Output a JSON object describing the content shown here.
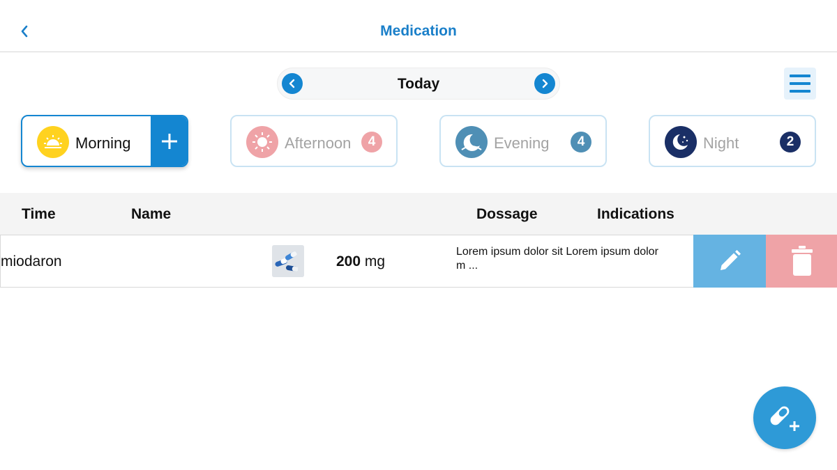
{
  "header": {
    "title": "Medication",
    "back_icon": "chevron-left-icon"
  },
  "date_nav": {
    "label": "Today",
    "prev_icon": "chevron-left-icon",
    "next_icon": "chevron-right-icon"
  },
  "menu_icon": "hamburger-menu-icon",
  "periods": [
    {
      "label": "Morning",
      "icon": "sunrise-icon",
      "icon_bg": "#ffd21f",
      "active": true,
      "action_icon": "plus-icon"
    },
    {
      "label": "Afternoon",
      "icon": "sun-icon",
      "icon_bg": "#efa3a7",
      "badge": "4",
      "badge_color": "#efa3a7"
    },
    {
      "label": "Evening",
      "icon": "moon-evening-icon",
      "icon_bg": "#4f8fb5",
      "badge": "4",
      "badge_color": "#4f8fb5"
    },
    {
      "label": "Night",
      "icon": "moon-stars-icon",
      "icon_bg": "#1a2f66",
      "badge": "2",
      "badge_color": "#1a2f66"
    }
  ],
  "table": {
    "columns": [
      "Time",
      "Name",
      "Dossage",
      "Indications"
    ],
    "rows": [
      {
        "name": "miodaron",
        "image": "pills-thumbnail",
        "dose_value": "200",
        "dose_unit": "mg",
        "indications": "Lorem ipsum dolor sit Lorem ipsum dolor m ..."
      }
    ]
  },
  "row_actions": {
    "edit_icon": "pencil-icon",
    "delete_icon": "trash-icon"
  },
  "fab_icon": "add-medication-icon",
  "colors": {
    "accent": "#1486d1",
    "edit": "#65b3e2",
    "delete": "#efa3a7",
    "morning": "#ffd21f",
    "afternoon": "#efa3a7",
    "evening": "#4f8fb5",
    "night": "#1a2f66"
  }
}
